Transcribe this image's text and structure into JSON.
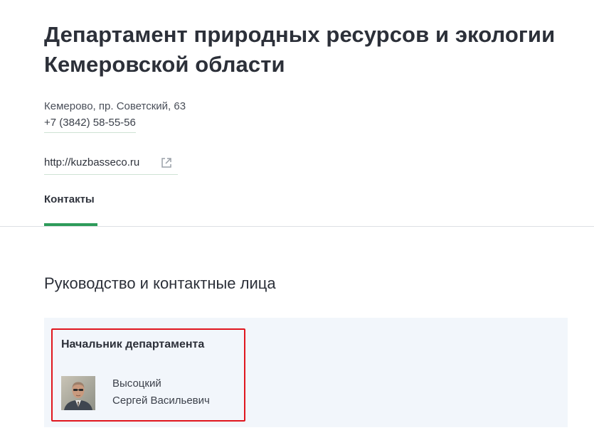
{
  "header": {
    "title_line1": "Департамент природных ресурсов и экологии",
    "title_line2": "Кемеровской области",
    "address": "Кемерово, пр. Советский, 63",
    "phone": "+7 (3842) 58-55-56",
    "website": "http://kuzbasseco.ru"
  },
  "tabs": [
    {
      "label": "Контакты",
      "active": true
    }
  ],
  "contacts_section": {
    "title": "Руководство и контактные лица",
    "persons": [
      {
        "role": "Начальник департамента",
        "last_name": "Высоцкий",
        "first_middle": "Сергей Васильевич",
        "photo": "person-photo"
      }
    ]
  },
  "colors": {
    "accent_green": "#2e9b5a",
    "highlight_red": "#e0161e",
    "panel_bg": "#f2f6fb"
  }
}
